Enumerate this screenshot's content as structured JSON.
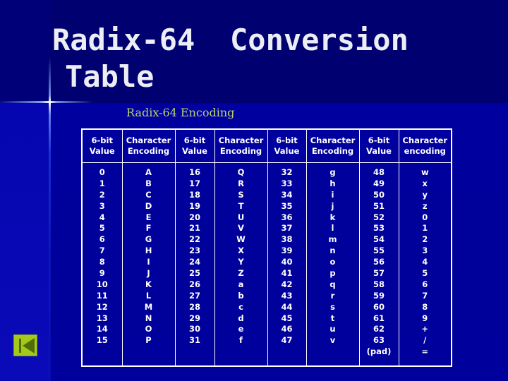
{
  "slide": {
    "title_words": [
      "Radix-64",
      "Conversion",
      "Table"
    ],
    "subtitle": "Radix-64 Encoding"
  },
  "table": {
    "headers": [
      [
        "6-bit",
        "Value"
      ],
      [
        "Character",
        "Encoding"
      ],
      [
        "6-bit",
        "Value"
      ],
      [
        "Character",
        "Encoding"
      ],
      [
        "6-bit",
        "Value"
      ],
      [
        "Character",
        "Encoding"
      ],
      [
        "6-bit",
        "Value"
      ],
      [
        "Character",
        "encoding"
      ]
    ],
    "columns": [
      [
        "0",
        "1",
        "2",
        "3",
        "4",
        "5",
        "6",
        "7",
        "8",
        "9",
        "10",
        "11",
        "12",
        "13",
        "14",
        "15"
      ],
      [
        "A",
        "B",
        "C",
        "D",
        "E",
        "F",
        "G",
        "H",
        "I",
        "J",
        "K",
        "L",
        "M",
        "N",
        "O",
        "P"
      ],
      [
        "16",
        "17",
        "18",
        "19",
        "20",
        "21",
        "22",
        "23",
        "24",
        "25",
        "26",
        "27",
        "28",
        "29",
        "30",
        "31"
      ],
      [
        "Q",
        "R",
        "S",
        "T",
        "U",
        "V",
        "W",
        "X",
        "Y",
        "Z",
        "a",
        "b",
        "c",
        "d",
        "e",
        "f"
      ],
      [
        "32",
        "33",
        "34",
        "35",
        "36",
        "37",
        "38",
        "39",
        "40",
        "41",
        "42",
        "43",
        "44",
        "45",
        "46",
        "47"
      ],
      [
        "g",
        "h",
        "i",
        "j",
        "k",
        "l",
        "m",
        "n",
        "o",
        "p",
        "q",
        "r",
        "s",
        "t",
        "u",
        "v"
      ],
      [
        "48",
        "49",
        "50",
        "51",
        "52",
        "53",
        "54",
        "55",
        "56",
        "57",
        "58",
        "59",
        "60",
        "61",
        "62",
        "63",
        "(pad)"
      ],
      [
        "w",
        "x",
        "y",
        "z",
        "0",
        "1",
        "2",
        "3",
        "4",
        "5",
        "6",
        "7",
        "8",
        "9",
        "+",
        "/",
        "="
      ]
    ]
  },
  "navigation": {
    "back_button_icon": "skip-back-icon"
  },
  "colors": {
    "title": "#ecedf5",
    "subtitle": "#b9d36a",
    "table_text": "#ffffff",
    "nav_button": "#a6c81a",
    "nav_icon": "#4e6d08"
  }
}
